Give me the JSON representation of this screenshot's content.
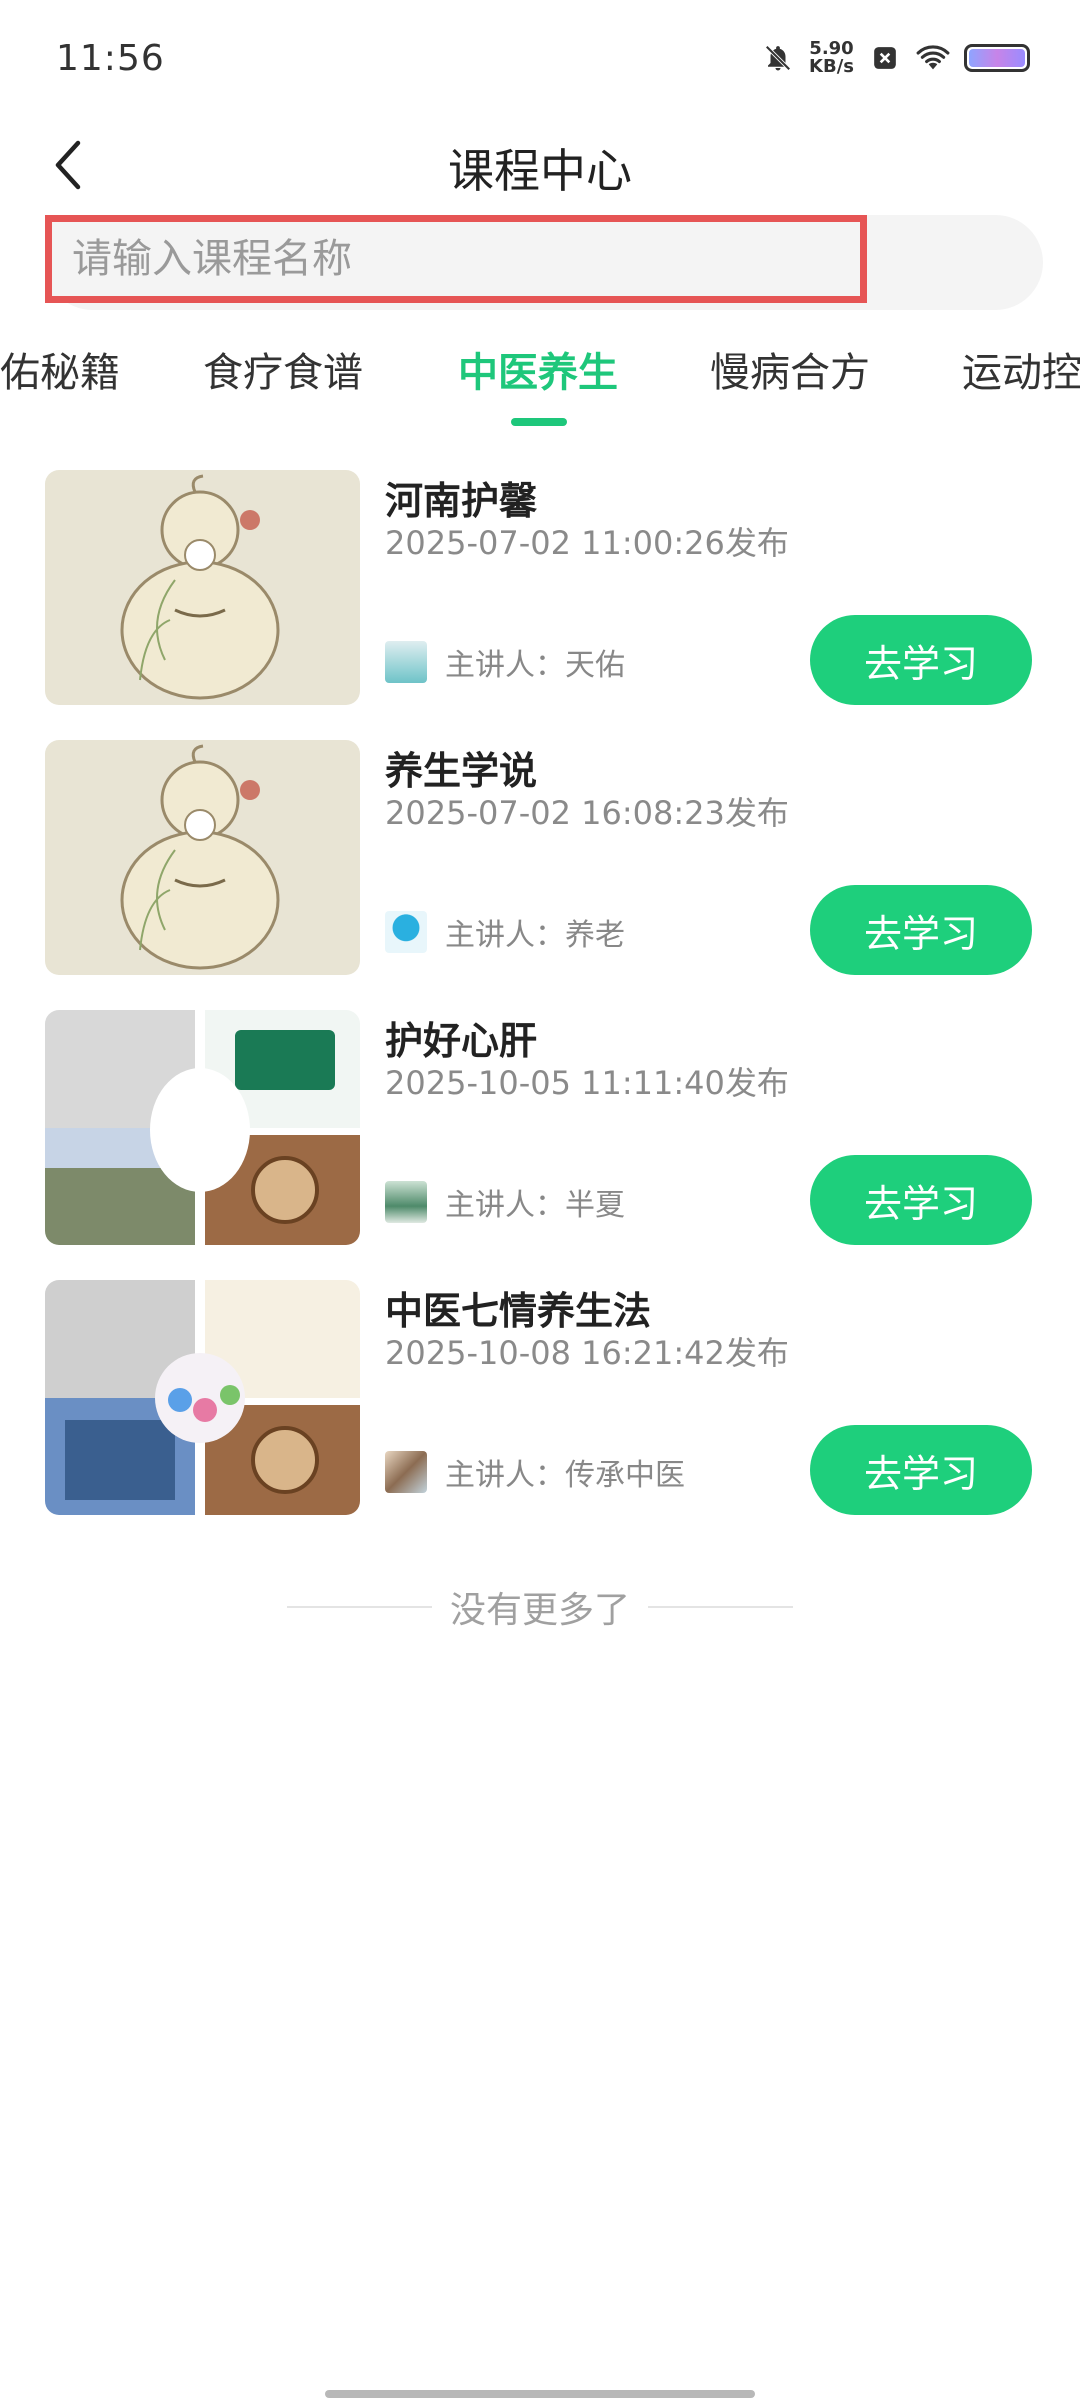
{
  "status": {
    "time": "11:56",
    "net_speed_value": "5.90",
    "net_speed_unit": "KB/s",
    "icons": [
      "bell-off-icon",
      "close-box-icon",
      "wifi-icon",
      "battery-icon"
    ]
  },
  "header": {
    "title": "课程中心",
    "back_icon": "chevron-left-icon"
  },
  "search": {
    "placeholder": "请输入课程名称"
  },
  "tabs": [
    {
      "label": "佑秘籍",
      "active": false
    },
    {
      "label": "食疗食谱",
      "active": false
    },
    {
      "label": "中医养生",
      "active": true
    },
    {
      "label": "慢病合方",
      "active": false
    },
    {
      "label": "运动控",
      "active": false
    }
  ],
  "courses": [
    {
      "title": "河南护馨",
      "date": "2025-07-02 11:00:26发布",
      "lecturer": "主讲人：天佑",
      "button": "去学习"
    },
    {
      "title": "养生学说",
      "date": "2025-07-02 16:08:23发布",
      "lecturer": "主讲人：养老",
      "button": "去学习"
    },
    {
      "title": "护好心肝",
      "date": "2025-10-05 11:11:40发布",
      "lecturer": "主讲人：半夏",
      "button": "去学习"
    },
    {
      "title": "中医七情养生法",
      "date": "2025-10-08 16:21:42发布",
      "lecturer": "主讲人：传承中医",
      "button": "去学习"
    }
  ],
  "footer": {
    "no_more": "没有更多了"
  },
  "colors": {
    "accent": "#1ecf7c",
    "highlight_border": "#e65555"
  }
}
